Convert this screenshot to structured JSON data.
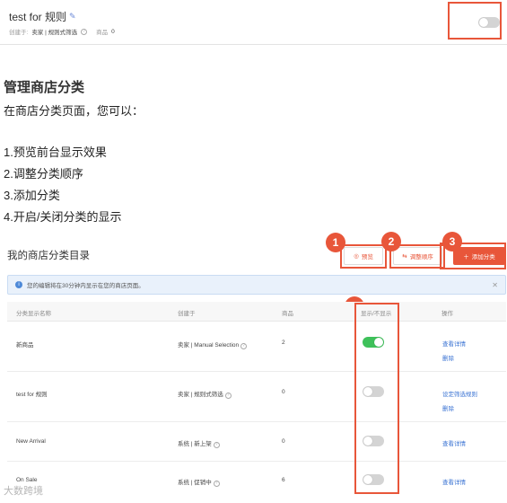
{
  "top_card": {
    "title": "test for 规则",
    "created_label": "创建于:",
    "created_value": "卖家 | 规则式筛选",
    "products_label": "商品",
    "products_value": "0"
  },
  "article": {
    "heading": "管理商店分类",
    "intro": "在商店分类页面，您可以：",
    "items": [
      "1.预览前台显示效果",
      "2.调整分类顺序",
      "3.添加分类",
      "4.开启/关闭分类的显示"
    ]
  },
  "panel": {
    "title": "我的商店分类目录",
    "buttons": {
      "preview": "预览",
      "reorder": "调整顺序",
      "add": "添加分类"
    },
    "badges": [
      "1",
      "2",
      "3",
      "4"
    ],
    "notice": "您的编辑将在30分钟内显示在您的商店页面。",
    "columns": {
      "name": "分类显示名称",
      "created": "创建于",
      "products": "商品",
      "visibility": "显示/不显示",
      "actions": "操作"
    },
    "rows": [
      {
        "name": "新商品",
        "created": "卖家 | Manual Selection",
        "products": "2",
        "visible": true,
        "actions": [
          "查看详情",
          "删除"
        ]
      },
      {
        "name": "test for 规则",
        "created": "卖家 | 规则式筛选",
        "products": "0",
        "visible": false,
        "actions": [
          "设定筛选规则",
          "删除"
        ]
      },
      {
        "name": "New Arrival",
        "created": "系统 | 新上架",
        "products": "0",
        "visible": false,
        "actions": [
          "查看详情"
        ]
      },
      {
        "name": "On Sale",
        "created": "系统 | 促销中",
        "products": "6",
        "visible": false,
        "actions": [
          "查看详情"
        ]
      }
    ]
  },
  "watermark": "大数跨境"
}
